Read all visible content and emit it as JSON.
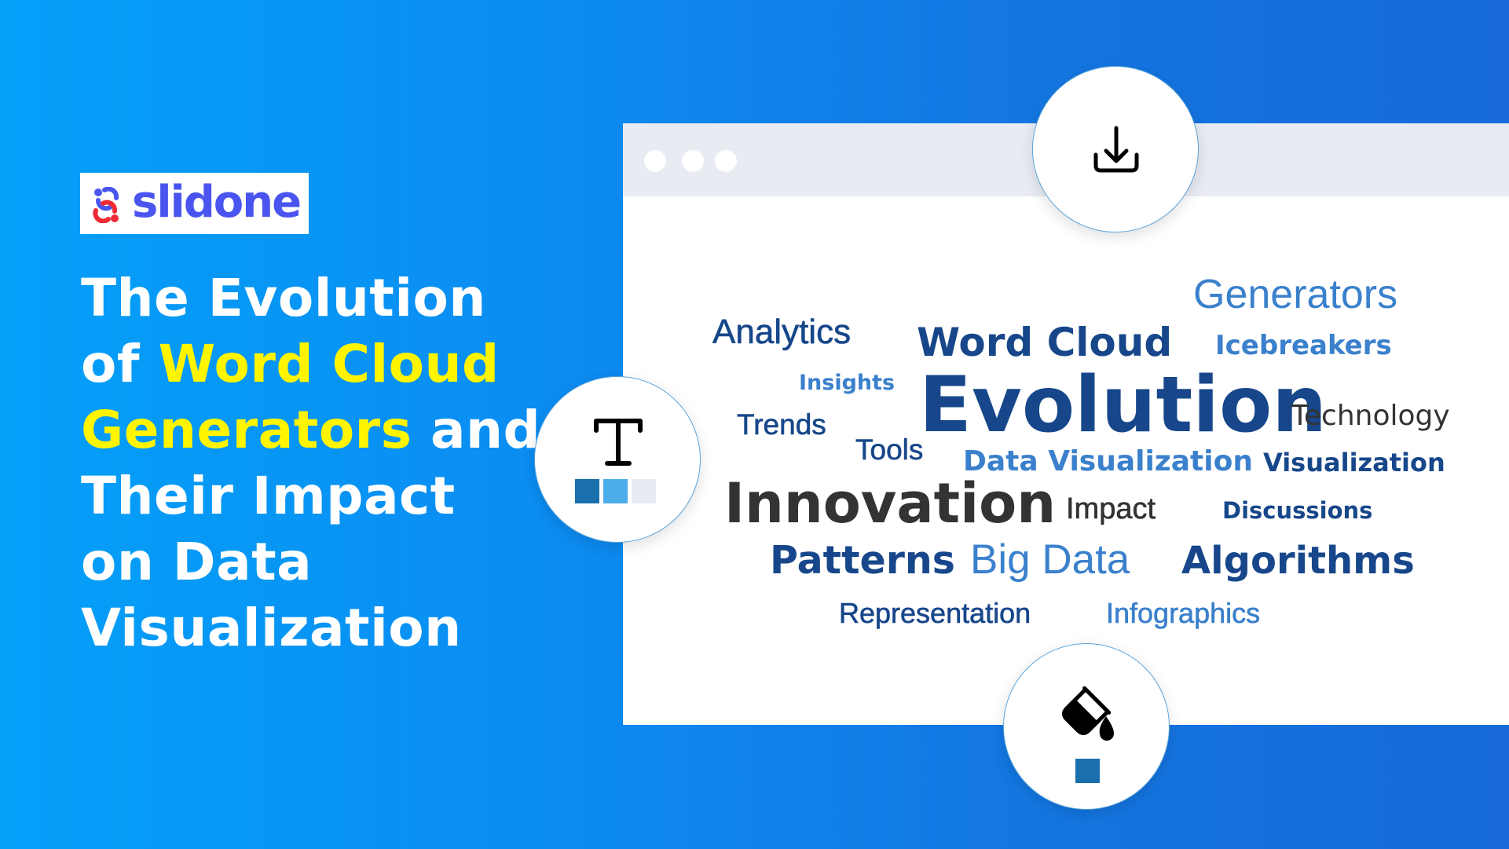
{
  "logo": {
    "brand_name": "slidone",
    "mark_icon": "slidone-logo-icon",
    "colors": {
      "primary": "#4a55f0",
      "secondary": "#ee2b35"
    }
  },
  "headline": {
    "lines": [
      [
        {
          "text": "The Evolution",
          "highlight": false
        }
      ],
      [
        {
          "text": "of ",
          "highlight": false
        },
        {
          "text": "Word Cloud",
          "highlight": true
        }
      ],
      [
        {
          "text": "Generators",
          "highlight": true
        },
        {
          "text": " and",
          "highlight": false
        }
      ],
      [
        {
          "text": "Their Impact",
          "highlight": false
        }
      ],
      [
        {
          "text": "on Data",
          "highlight": false
        }
      ],
      [
        {
          "text": "Visualization",
          "highlight": false
        }
      ]
    ],
    "text_color": "#ffffff",
    "highlight_color": "#fff500"
  },
  "browser_window": {
    "titlebar_dots": 3
  },
  "word_cloud": {
    "colors": {
      "navy": "#17478a",
      "blue": "#3a80cc",
      "gray": "#333333"
    },
    "words": [
      {
        "text": "Generators",
        "color": "blue",
        "weight": "light",
        "rank": 3
      },
      {
        "text": "Analytics",
        "color": "navy",
        "weight": "medium",
        "rank": 5
      },
      {
        "text": "Word Cloud",
        "color": "navy",
        "weight": "bold",
        "rank": 3
      },
      {
        "text": "Icebreakers",
        "color": "blue",
        "weight": "bold",
        "rank": 6
      },
      {
        "text": "Insights",
        "color": "blue",
        "weight": "semibold",
        "rank": 9
      },
      {
        "text": "Evolution",
        "color": "navy",
        "weight": "bold",
        "rank": 1
      },
      {
        "text": "Technology",
        "color": "gray",
        "weight": "regular",
        "rank": 6
      },
      {
        "text": "Trends",
        "color": "navy",
        "weight": "medium",
        "rank": 6
      },
      {
        "text": "Tools",
        "color": "navy",
        "weight": "medium",
        "rank": 6
      },
      {
        "text": "Data Visualization",
        "color": "blue",
        "weight": "bold",
        "rank": 6
      },
      {
        "text": "Visualization",
        "color": "navy",
        "weight": "bold",
        "rank": 7
      },
      {
        "text": "Innovation",
        "color": "gray",
        "weight": "semibold",
        "rank": 2
      },
      {
        "text": "Impact",
        "color": "gray",
        "weight": "medium",
        "rank": 6
      },
      {
        "text": "Discussions",
        "color": "navy",
        "weight": "semibold",
        "rank": 8
      },
      {
        "text": "Patterns",
        "color": "navy",
        "weight": "bold",
        "rank": 4
      },
      {
        "text": "Big Data",
        "color": "blue",
        "weight": "light",
        "rank": 3
      },
      {
        "text": "Algorithms",
        "color": "navy",
        "weight": "bold",
        "rank": 4
      },
      {
        "text": "Representation",
        "color": "navy",
        "weight": "medium",
        "rank": 6
      },
      {
        "text": "Infographics",
        "color": "blue",
        "weight": "medium",
        "rank": 6
      }
    ]
  },
  "tool_buttons": {
    "download": {
      "icon": "download-icon"
    },
    "text_style": {
      "icon": "text-icon",
      "swatches": [
        "#1a6fad",
        "#4baeea",
        "#e8ebf2"
      ]
    },
    "fill_color": {
      "icon": "paint-bucket-icon",
      "swatches": [
        "#1a6fad"
      ]
    }
  }
}
